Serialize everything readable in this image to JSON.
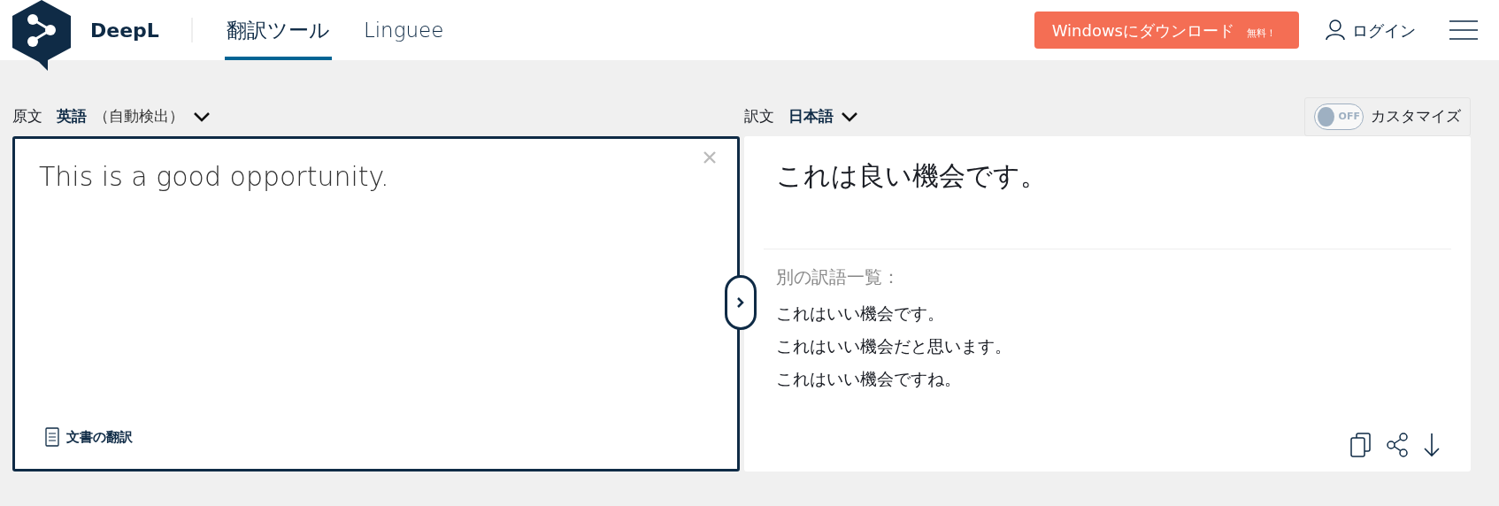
{
  "header": {
    "logo_text": "DeepL",
    "tabs": [
      {
        "label": "翻訳ツール",
        "selected": true
      },
      {
        "label": "Linguee",
        "selected": false
      }
    ],
    "download_button": {
      "label": "Windowsにダウンロード",
      "badge": "無料！"
    },
    "login": "ログイン"
  },
  "source": {
    "label": "原文",
    "language": "英語",
    "detect": "（自動検出）",
    "text": "This is a good opportunity.",
    "document_link": "文書の翻訳"
  },
  "target": {
    "label": "訳文",
    "language": "日本語",
    "customize": {
      "label": "カスタマイズ",
      "on": false,
      "state_text": "OFF"
    },
    "translation": "これは良い機会です。",
    "alternatives_title": "別の訳語一覧：",
    "alternatives": [
      "これはいい機会です。",
      "これはいい機会だと思います。",
      "これはいい機会ですね。"
    ]
  }
}
